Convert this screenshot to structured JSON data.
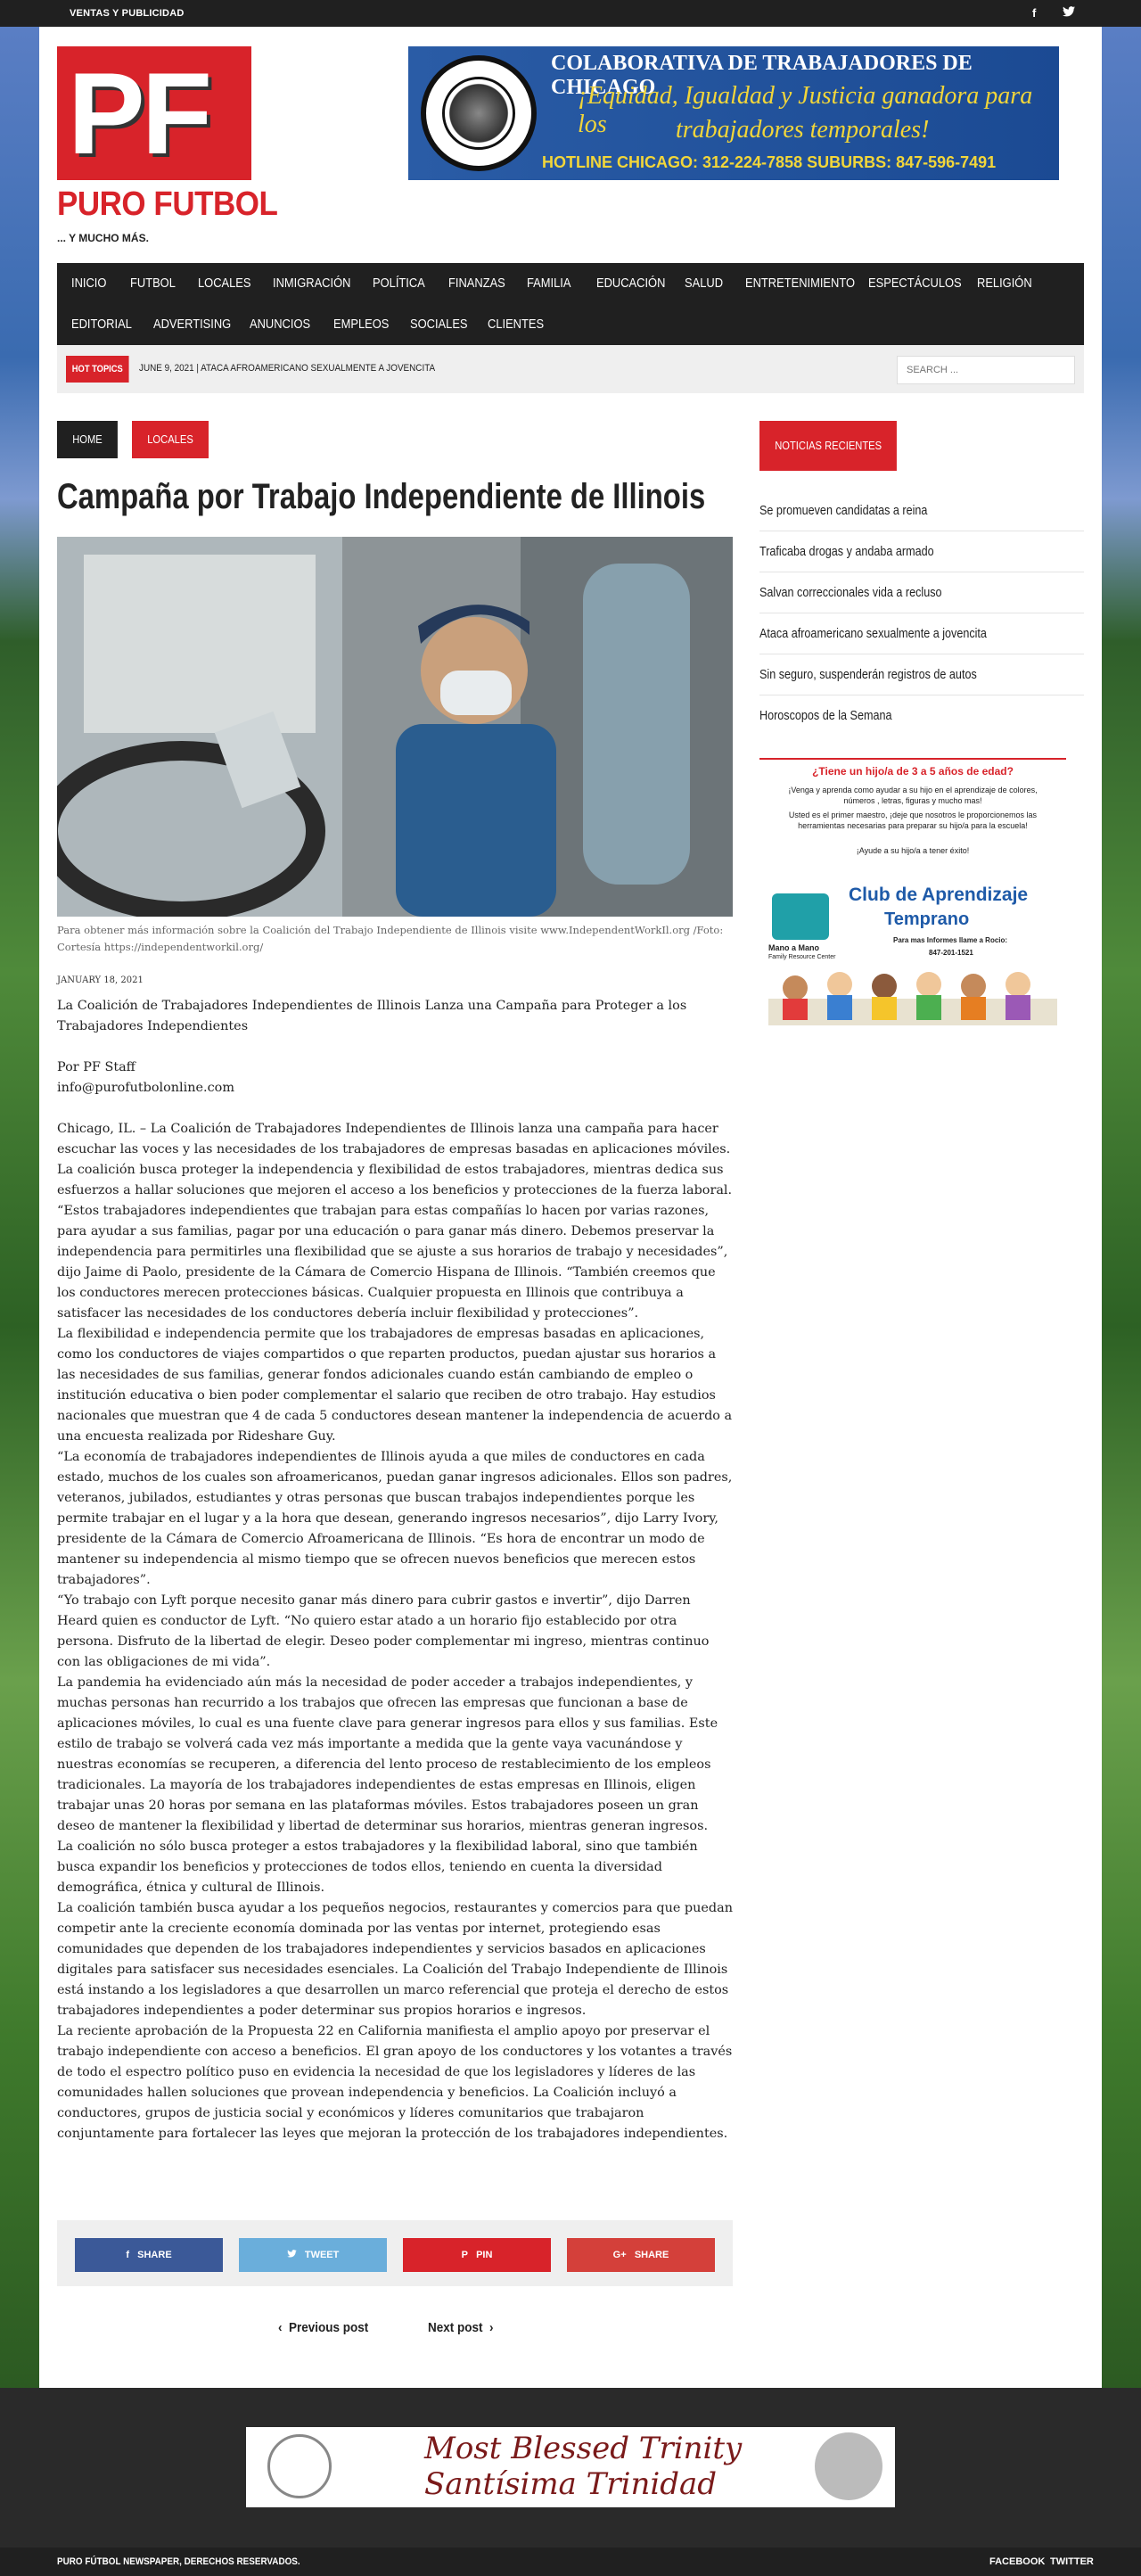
{
  "topbar": {
    "link": "VENTAS Y PUBLICIDAD"
  },
  "logo": {
    "letters": "PF",
    "name": "PURO FUTBOL",
    "tagline": "... Y MUCHO MÁS."
  },
  "top_banner": {
    "line1": "COLABORATIVA DE TRABAJADORES DE CHICAGO",
    "line2": "¡Equidad, Igualdad y Justicia ganadora para los",
    "line3": "trabajadores temporales!",
    "line4": "HOTLINE  CHICAGO: 312-224-7858  SUBURBS: 847-596-7491"
  },
  "nav": {
    "row1": [
      "INICIO",
      "FUTBOL",
      "LOCALES",
      "INMIGRACIÓN",
      "POLÍTICA",
      "FINANZAS",
      "FAMILIA",
      "EDUCACIÓN",
      "SALUD",
      "ENTRETENIMIENTO",
      "ESPECTÁCULOS",
      "RELIGIÓN"
    ],
    "row2": [
      "EDITORIAL",
      "ADVERTISING",
      "ANUNCIOS",
      "EMPLEOS",
      "SOCIALES",
      "CLIENTES"
    ]
  },
  "hot_topics": {
    "badge": "HOT TOPICS",
    "text": "JUNE 9, 2021  |  ATACA AFROAMERICANO SEXUALMENTE A JOVENCITA",
    "search_placeholder": "SEARCH ..."
  },
  "breadcrumbs": [
    "HOME",
    "LOCALES"
  ],
  "article": {
    "title": "Campaña por Trabajo Independiente de Illinois",
    "caption": "Para obtener más información sobre la Coalición del Trabajo Independiente de Illinois visite www.IndependentWorkIl.org /Foto: Cortesía https://independentworkil.org/",
    "date": "JANUARY 18, 2021",
    "paragraphs": [
      "La Coalición de Trabajadores Independientes de Illinois Lanza una Campaña para Proteger a los Trabajadores Independientes",
      "",
      "Por PF Staff",
      "info@purofutbolonline.com",
      "",
      "Chicago, IL. – La Coalición de Trabajadores Independientes de Illinois lanza una campaña para hacer escuchar las voces y las necesidades de los trabajadores de empresas basadas en aplicaciones móviles. La coalición busca proteger la independencia y flexibilidad de estos trabajadores, mientras dedica sus esfuerzos a hallar soluciones que mejoren el acceso a los beneficios y protecciones de la fuerza laboral.",
      "“Estos trabajadores independientes que trabajan para estas compañías lo hacen por varias razones, para ayudar a sus familias, pagar por una educación o para ganar más dinero. Debemos preservar la independencia para permitirles una flexibilidad que se ajuste a sus horarios de trabajo y necesidades”, dijo Jaime di Paolo, presidente de la Cámara de Comercio Hispana de Illinois. “También creemos que los conductores merecen protecciones básicas. Cualquier propuesta en Illinois que contribuya a satisfacer las necesidades de los conductores debería incluir flexibilidad y protecciones”.",
      "La flexibilidad e independencia permite que los trabajadores de empresas basadas en aplicaciones, como los conductores de viajes compartidos o que reparten productos, puedan ajustar sus horarios a las necesidades de sus familias, generar fondos adicionales cuando están cambiando de empleo o institución educativa o bien poder complementar el salario que reciben de otro trabajo. Hay estudios nacionales que muestran que 4 de cada 5 conductores desean mantener la independencia de acuerdo a una encuesta realizada por Rideshare Guy.",
      "“La economía de trabajadores independientes de Illinois ayuda a que miles de conductores en cada estado, muchos de los cuales son afroamericanos, puedan ganar ingresos adicionales. Ellos son padres, veteranos, jubilados, estudiantes y otras personas que buscan trabajos independientes porque les permite trabajar en el lugar y a la hora que desean, generando ingresos necesarios”, dijo Larry Ivory, presidente de la Cámara de Comercio Afroamericana de Illinois. “Es hora de encontrar un modo de mantener su independencia al mismo tiempo que se ofrecen nuevos beneficios que merecen estos trabajadores”.",
      "“Yo trabajo con Lyft porque necesito ganar más dinero para cubrir gastos e invertir”, dijo Darren Heard quien es conductor de Lyft. “No quiero estar atado a un horario fijo establecido por otra persona. Disfruto de la libertad de elegir. Deseo poder complementar mi ingreso, mientras continuo con las obligaciones de mi vida”.",
      "La pandemia ha evidenciado aún más la necesidad de poder acceder a trabajos independientes, y muchas personas han recurrido a los trabajos que ofrecen las empresas que funcionan a base de aplicaciones móviles, lo cual es una fuente clave para generar ingresos para ellos y sus familias. Este estilo de trabajo se volverá cada vez más importante a medida que la gente vaya vacunándose y nuestras economías se recuperen, a diferencia del lento proceso de restablecimiento de los empleos tradicionales. La mayoría de los trabajadores independientes de estas empresas en Illinois, eligen trabajar unas 20 horas por semana en las plataformas móviles. Estos trabajadores poseen un gran deseo de mantener la flexibilidad y libertad de determinar sus horarios, mientras generan ingresos.",
      "La coalición no sólo busca proteger a estos trabajadores y la flexibilidad laboral, sino que también busca expandir los beneficios y protecciones de todos ellos, teniendo en cuenta la diversidad demográfica, étnica y cultural de Illinois.",
      "La coalición también busca ayudar a los pequeños negocios, restaurantes y comercios para que puedan competir ante la creciente economía dominada por las ventas por internet, protegiendo esas comunidades que dependen de los trabajadores independientes y servicios basados en aplicaciones digitales para satisfacer sus necesidades esenciales. La Coalición del Trabajo Independiente de Illinois está instando a los legisladores a que desarrollen un marco referencial que proteja el derecho de estos trabajadores independientes a poder determinar sus propios horarios e ingresos.",
      "La reciente aprobación de la Propuesta 22 en California manifiesta el amplio apoyo por preservar el trabajo independiente con acceso a beneficios. El gran apoyo de los conductores y los votantes a través de todo el espectro político puso en evidencia la necesidad de que los legisladores y líderes de las comunidades hallen soluciones que provean independencia y beneficios. La Coalición incluyó a conductores, grupos de justicia social y económicos y líderes comunitarios que trabajaron conjuntamente para fortalecer las leyes que mejoran la protección de los trabajadores independientes."
    ]
  },
  "share": {
    "buttons": [
      {
        "label": "SHARE",
        "icon": "f",
        "color": "#3b5998"
      },
      {
        "label": "TWEET",
        "icon": "🐦",
        "color": "#6aaedb"
      },
      {
        "label": "PIN",
        "icon": "P",
        "color": "#d8232a"
      },
      {
        "label": "SHARE",
        "icon": "G+",
        "color": "#d4403a"
      }
    ]
  },
  "pager": {
    "prev": "Previous post",
    "next": "Next post"
  },
  "sidebar": {
    "heading": "NOTICIAS RECIENTES",
    "items": [
      "Se promueven candidatas a reina",
      "Traficaba drogas y andaba armado",
      "Salvan correccionales vida a recluso",
      "Ataca afroamericano sexualmente a jovencita",
      "Sin seguro, suspenderán registros de autos",
      "Horoscopos de la Semana"
    ],
    "ad": {
      "question": "¿Tiene un hijo/a de 3 a 5 años de edad?",
      "line1": "¡Venga y aprenda como ayudar a su hijo en el aprendizaje de colores, números , letras, figuras y mucho mas!",
      "line2": "Usted es el primer maestro, ¡deje que nosotros le proporcionemos las herramientas necesarias para preparar su hijo/a para la escuela!",
      "line3": "¡Ayude a su hijo/a a tener éxito!",
      "club": "Club de Aprendizaje",
      "temprano": "Temprano",
      "mano": "Mano a Mano",
      "mano_sub": "Family Resource Center",
      "info": "Para mas Informes llame a Rocio:",
      "phone": "847-201-1521"
    }
  },
  "footer": {
    "ad_line1": "Most Blessed Trinity",
    "ad_line2": "Santísima Trinidad",
    "copyright": "PURO FÚTBOL NEWSPAPER, DERECHOS RESERVADOS.",
    "facebook": "FACEBOOK",
    "twitter": "TWITTER"
  }
}
